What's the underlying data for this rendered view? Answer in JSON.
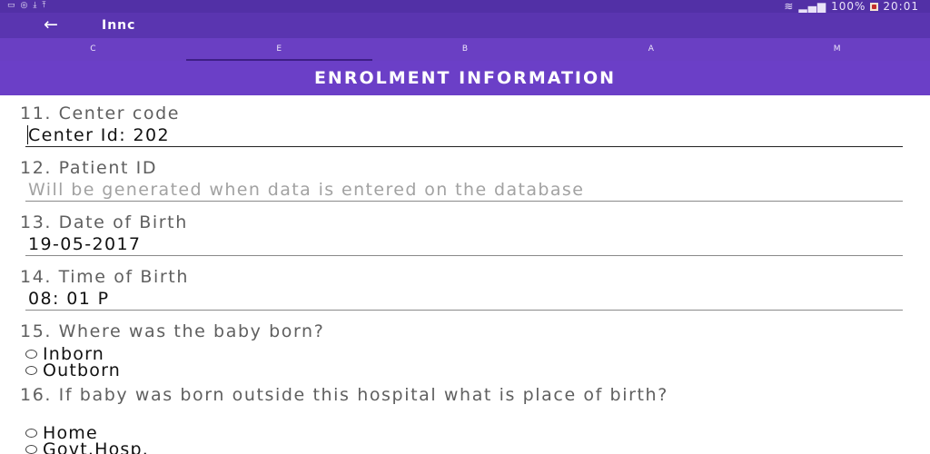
{
  "status": {
    "left_icons": [
      "gallery-icon",
      "sync-icon",
      "download-icon",
      "upload-icon"
    ],
    "battery_percent": "100%",
    "time": "20:01"
  },
  "appbar": {
    "title": "Innc"
  },
  "tabs": [
    {
      "label": "C"
    },
    {
      "label": "E"
    },
    {
      "label": "B"
    },
    {
      "label": "A"
    },
    {
      "label": "M"
    }
  ],
  "section": {
    "title": "ENROLMENT INFORMATION"
  },
  "form": {
    "q11": {
      "label": "11. Center code",
      "value": "Center Id: 202"
    },
    "q12": {
      "label": "12. Patient ID",
      "placeholder": "Will be generated when data is entered on the database"
    },
    "q13": {
      "label": "13. Date of Birth",
      "value": "19-05-2017"
    },
    "q14": {
      "label": "14. Time of Birth",
      "value": "08: 01 P"
    },
    "q15": {
      "label": "15. Where was the baby born?",
      "options": [
        "Inborn",
        "Outborn"
      ]
    },
    "q16": {
      "label": "16. If baby was born outside this hospital what is place of birth?",
      "options": [
        "Home",
        "Govt.Hosp."
      ]
    }
  },
  "colors": {
    "status_bar": "#5230a6",
    "app_bar": "#5a35b0",
    "tab_bar": "#6a3fc3",
    "header": "#6b3fc7"
  }
}
